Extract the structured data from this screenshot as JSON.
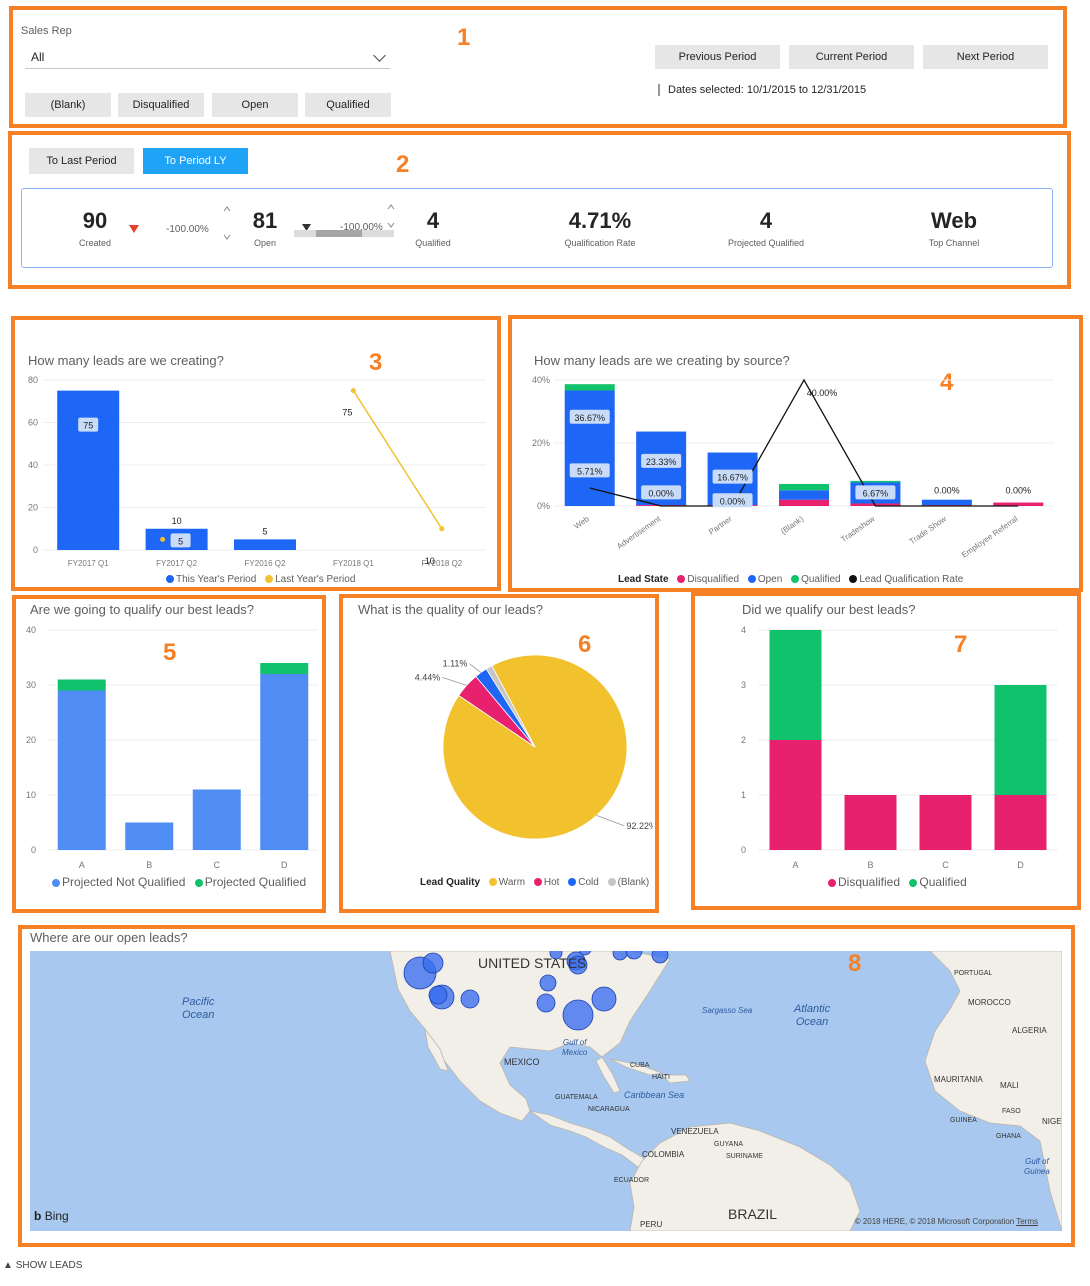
{
  "colors": {
    "accent": "#f58025",
    "blue": "#1e66f5",
    "dark_blue": "#1a5ad6",
    "pink": "#e8216e",
    "green": "#11c26d",
    "black": "#111111",
    "yellow": "#f2c12e",
    "light_blue": "#4f8df5",
    "gray": "#c8c6c4",
    "active_button": "#1fa3f7",
    "down_arrow": "#e8412c"
  },
  "section_numbers": [
    "1",
    "2",
    "3",
    "4",
    "5",
    "6",
    "7",
    "8"
  ],
  "filters": {
    "sales_rep_label": "Sales Rep",
    "sales_rep_value": "All",
    "lead_state_buttons": [
      "(Blank)",
      "Disqualified",
      "Open",
      "Qualified"
    ],
    "period_buttons": [
      "Previous Period",
      "Current Period",
      "Next Period"
    ],
    "dates_selected": "Dates selected: 10/1/2015 to 12/31/2015"
  },
  "comparison": {
    "buttons": [
      "To Last Period",
      "To Period LY"
    ],
    "active_button": "To Period LY",
    "kpis": [
      {
        "value": "90",
        "label": "Created"
      },
      {
        "value": "81",
        "label": "Open"
      },
      {
        "value": "4",
        "label": "Qualified"
      },
      {
        "value": "4.71%",
        "label": "Qualification Rate"
      },
      {
        "value": "4",
        "label": "Projected Qualified"
      },
      {
        "value": "Web",
        "label": "Top Channel"
      }
    ],
    "change_1": "-100.00%",
    "change_2": "-100.00%",
    "down_arrow_icon": "triangle-down-icon"
  },
  "chart_leads_created": {
    "title": "How many leads are we creating?",
    "type": "bar",
    "categories": [
      "FY2017 Q1",
      "FY2017 Q2",
      "FY2016 Q2",
      "FY2018 Q1",
      "FY2018 Q2"
    ],
    "series": [
      {
        "name": "This Year's Period",
        "values": [
          75,
          10,
          5,
          0,
          0
        ]
      },
      {
        "name": "Last Year's Period",
        "values": [
          null,
          5,
          null,
          75,
          10
        ]
      }
    ],
    "y_ticks": [
      "0",
      "20",
      "40",
      "60",
      "80"
    ],
    "ylim": [
      0,
      80
    ],
    "data_labels": [
      "75",
      "10",
      "5",
      "5",
      "75",
      "10"
    ]
  },
  "chart_by_source": {
    "title": "How many leads are we creating by source?",
    "type": "bar",
    "categories": [
      "Web",
      "Advertisement",
      "Partner",
      "(Blank)",
      "Tradeshow",
      "Trade Show",
      "Employee Referral"
    ],
    "series": [
      {
        "name": "Disqualified",
        "values": [
          0,
          0.3,
          0.3,
          2,
          0.8,
          0.3,
          1.1
        ]
      },
      {
        "name": "Open",
        "values": [
          36.67,
          23.33,
          16.67,
          3,
          6.67,
          1.7,
          0
        ]
      },
      {
        "name": "Qualified",
        "values": [
          2,
          0,
          0,
          2,
          0.5,
          0,
          0
        ]
      },
      {
        "name": "Lead Qualification Rate",
        "values": [
          5.71,
          0,
          0,
          40,
          0,
          0,
          0
        ]
      }
    ],
    "y_ticks": [
      "0%",
      "20%",
      "40%"
    ],
    "ylim": [
      0,
      40
    ],
    "data_labels": [
      "36.67%",
      "5.71%",
      "23.33%",
      "0.00%",
      "16.67%",
      "0.00%",
      "40.00%",
      "6.67%",
      "0.00%",
      "0.00%"
    ],
    "legend_title": "Lead State"
  },
  "chart_qualify_best": {
    "title": "Are we going to qualify our best leads?",
    "type": "bar",
    "categories": [
      "A",
      "B",
      "C",
      "D"
    ],
    "series": [
      {
        "name": "Projected Not Qualified",
        "values": [
          29,
          5,
          11,
          32
        ]
      },
      {
        "name": "Projected Qualified",
        "values": [
          2,
          0,
          0,
          2
        ]
      }
    ],
    "y_ticks": [
      "0",
      "10",
      "20",
      "30",
      "40"
    ],
    "ylim": [
      0,
      40
    ]
  },
  "chart_quality": {
    "title": "What is the quality of our leads?",
    "type": "pie",
    "legend_title": "Lead Quality",
    "slices": [
      {
        "name": "Warm",
        "value": 92.22,
        "label": "92.22%"
      },
      {
        "name": "Hot",
        "value": 4.44,
        "label": "4.44%"
      },
      {
        "name": "Cold",
        "value": 2.22,
        "label": "1.11%"
      },
      {
        "name": "(Blank)",
        "value": 1.11,
        "label": ""
      }
    ]
  },
  "chart_qualified_best": {
    "title": "Did we qualify our best leads?",
    "type": "bar",
    "categories": [
      "A",
      "B",
      "C",
      "D"
    ],
    "series": [
      {
        "name": "Disqualified",
        "values": [
          2,
          1,
          1,
          1
        ]
      },
      {
        "name": "Qualified",
        "values": [
          2,
          0,
          0,
          2
        ]
      }
    ],
    "y_ticks": [
      "0",
      "1",
      "2",
      "3",
      "4"
    ],
    "ylim": [
      0,
      4
    ]
  },
  "map": {
    "title": "Where are our open leads?",
    "labels": {
      "united_states": "UNITED STATES",
      "mexico": "MEXICO",
      "brazil": "BRAZIL",
      "pacific": "Pacific\nOcean",
      "atlantic": "Atlantic\nOcean",
      "sargasso": "Sargasso Sea",
      "gulf": "Gulf of\nMexico",
      "caribbean": "Caribbean Sea",
      "cuba": "CUBA",
      "haiti": "HAITI",
      "guatemala": "GUATEMALA",
      "nicaragua": "NICARAGUA",
      "venezuela": "VENEZUELA",
      "guyana": "GUYANA",
      "suriname": "SURINAME",
      "colombia": "COLOMBIA",
      "ecuador": "ECUADOR",
      "peru": "PERU",
      "portugal": "PORTUGAL",
      "morocco": "MOROCCO",
      "algeria": "ALGERIA",
      "mauritania": "MAURITANIA",
      "mali": "MALI",
      "burkina": "FASO",
      "guinea": "GUINEA",
      "ghana": "GHANA",
      "niger": "NIGE",
      "gulf_guinea": "Gulf of\nGuinea"
    },
    "bing": "Bing",
    "copyright": "© 2018 HERE, © 2018 Microsoft Corporation",
    "terms": "Terms"
  },
  "footer": {
    "show_leads": "SHOW LEADS"
  }
}
